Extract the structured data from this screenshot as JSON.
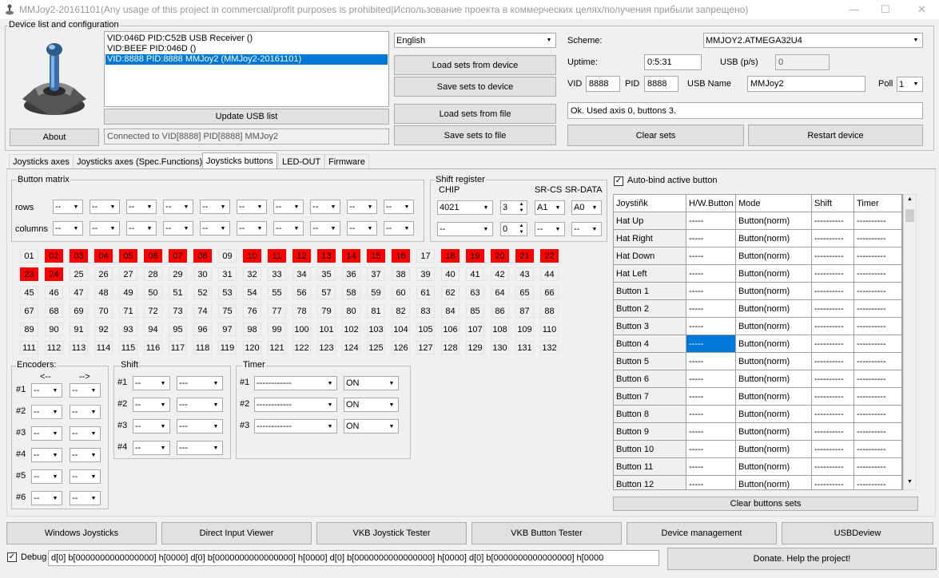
{
  "window": {
    "title": "MMJoy2-20161101(Any usage of this project in commercial/profit purposes is prohibited|Использование проекта в коммерческих целях/получения прибыли запрещено)",
    "min": "—",
    "max": "☐",
    "close": "✕"
  },
  "device": {
    "group_label": "Device list and configuration",
    "list": [
      "VID:046D PID:C52B USB Receiver ()",
      "VID:BEEF PID:046D  ()",
      "VID:8888 PID:8888 MMJoy2 (MMJoy2-20161101)"
    ],
    "selected_index": 2,
    "update_usb_label": "Update USB list",
    "about_label": "About",
    "status": "Connected to VID[8888] PID[8888] MMJoy2",
    "language": "English",
    "load_device_label": "Load sets from device",
    "save_device_label": "Save sets to device",
    "load_file_label": "Load sets from file",
    "save_file_label": "Save sets to file",
    "scheme_label": "Scheme:",
    "scheme": "MMJOY2.ATMEGA32U4",
    "uptime_label": "Uptime:",
    "uptime": "0:5:31",
    "usbps_label": "USB (p/s)",
    "usbps": "0",
    "vid_label": "VID",
    "vid": "8888",
    "pid_label": "PID",
    "pid": "8888",
    "usbname_label": "USB Name",
    "usbname": "MMJoy2",
    "poll_label": "Poll",
    "poll": "1",
    "info": "Ok. Used axis  0, buttons 3.",
    "clear_sets_label": "Clear sets",
    "restart_label": "Restart device"
  },
  "tabs": [
    "Joysticks axes",
    "Joysticks axes (Spec.Functions)",
    "Joysticks buttons",
    "LED-OUT",
    "Firmware"
  ],
  "active_tab": 2,
  "matrix": {
    "group_label": "Button matrix",
    "rows_label": "rows",
    "columns_label": "columns",
    "value": "--"
  },
  "shiftreg": {
    "group_label": "Shift register",
    "chip_label": "CHIP",
    "srcs_label": "SR-CS",
    "srdata_label": "SR-DATA",
    "chip1": "4021",
    "count1": "3",
    "cs1": "A1",
    "data1": "A0",
    "chip2": "--",
    "count2": "0",
    "cs2": "--",
    "data2": "--"
  },
  "buttons": {
    "labels": [
      "01",
      "02",
      "03",
      "04",
      "05",
      "06",
      "07",
      "08",
      "09",
      "10",
      "11",
      "12",
      "13",
      "14",
      "15",
      "16",
      "17",
      "18",
      "19",
      "20",
      "21",
      "22",
      "23",
      "24",
      "25",
      "26",
      "27",
      "28",
      "29",
      "30",
      "31",
      "32",
      "33",
      "34",
      "35",
      "36",
      "37",
      "38",
      "39",
      "40",
      "41",
      "42",
      "43",
      "44",
      "45",
      "46",
      "47",
      "48",
      "49",
      "50",
      "51",
      "52",
      "53",
      "54",
      "55",
      "56",
      "57",
      "58",
      "59",
      "60",
      "61",
      "62",
      "63",
      "64",
      "65",
      "66",
      "67",
      "68",
      "69",
      "70",
      "71",
      "72",
      "73",
      "74",
      "75",
      "76",
      "77",
      "78",
      "79",
      "80",
      "81",
      "82",
      "83",
      "84",
      "85",
      "86",
      "87",
      "88",
      "89",
      "90",
      "91",
      "92",
      "93",
      "94",
      "95",
      "96",
      "97",
      "98",
      "99",
      "100",
      "101",
      "102",
      "103",
      "104",
      "105",
      "106",
      "107",
      "108",
      "109",
      "110",
      "111",
      "112",
      "113",
      "114",
      "115",
      "116",
      "117",
      "118",
      "119",
      "120",
      "121",
      "122",
      "123",
      "124",
      "125",
      "126",
      "127",
      "128",
      "129",
      "130",
      "131",
      "132"
    ],
    "active": [
      "02",
      "03",
      "04",
      "05",
      "06",
      "07",
      "08",
      "10",
      "11",
      "12",
      "13",
      "14",
      "15",
      "16",
      "18",
      "19",
      "20",
      "21",
      "22",
      "23",
      "24"
    ],
    "active_color": "#ff0000"
  },
  "encoders": {
    "group_label": "Encoders:",
    "left_label": "<--",
    "right_label": "-->",
    "rows": [
      "#1",
      "#2",
      "#3",
      "#4",
      "#5",
      "#6"
    ],
    "value": "--"
  },
  "shift": {
    "group_label": "Shift",
    "rows": [
      "#1",
      "#2",
      "#3",
      "#4"
    ],
    "value1": "--",
    "value2": "---"
  },
  "timer": {
    "group_label": "Timer",
    "rows": [
      "#1",
      "#2",
      "#3"
    ],
    "value": "------------",
    "state": "ON"
  },
  "grid": {
    "autobind_label": "Auto-bind active button",
    "autobind_checked": "✓",
    "headers": [
      "Joystiñk",
      "H/W.Button",
      "Mode",
      "Shift",
      "Timer"
    ],
    "rows": [
      {
        "name": "Hat Up",
        "hw": "-----",
        "mode": "Button(norm)",
        "shift": "----------",
        "timer": "----------"
      },
      {
        "name": "Hat Right",
        "hw": "-----",
        "mode": "Button(norm)",
        "shift": "----------",
        "timer": "----------"
      },
      {
        "name": "Hat Down",
        "hw": "-----",
        "mode": "Button(norm)",
        "shift": "----------",
        "timer": "----------"
      },
      {
        "name": "Hat Left",
        "hw": "-----",
        "mode": "Button(norm)",
        "shift": "----------",
        "timer": "----------"
      },
      {
        "name": "Button 1",
        "hw": "-----",
        "mode": "Button(norm)",
        "shift": "----------",
        "timer": "----------"
      },
      {
        "name": "Button 2",
        "hw": "-----",
        "mode": "Button(norm)",
        "shift": "----------",
        "timer": "----------"
      },
      {
        "name": "Button 3",
        "hw": "-----",
        "mode": "Button(norm)",
        "shift": "----------",
        "timer": "----------"
      },
      {
        "name": "Button 4",
        "hw": "-----",
        "mode": "Button(norm)",
        "shift": "----------",
        "timer": "----------"
      },
      {
        "name": "Button 5",
        "hw": "-----",
        "mode": "Button(norm)",
        "shift": "----------",
        "timer": "----------"
      },
      {
        "name": "Button 6",
        "hw": "-----",
        "mode": "Button(norm)",
        "shift": "----------",
        "timer": "----------"
      },
      {
        "name": "Button 7",
        "hw": "-----",
        "mode": "Button(norm)",
        "shift": "----------",
        "timer": "----------"
      },
      {
        "name": "Button 8",
        "hw": "-----",
        "mode": "Button(norm)",
        "shift": "----------",
        "timer": "----------"
      },
      {
        "name": "Button 9",
        "hw": "-----",
        "mode": "Button(norm)",
        "shift": "----------",
        "timer": "----------"
      },
      {
        "name": "Button 10",
        "hw": "-----",
        "mode": "Button(norm)",
        "shift": "----------",
        "timer": "----------"
      },
      {
        "name": "Button 11",
        "hw": "-----",
        "mode": "Button(norm)",
        "shift": "----------",
        "timer": "----------"
      },
      {
        "name": "Button 12",
        "hw": "-----",
        "mode": "Button(norm)",
        "shift": "----------",
        "timer": "----------"
      }
    ],
    "selected_row": 7,
    "clear_buttons_label": "Clear buttons sets"
  },
  "bottom": {
    "windows_joysticks": "Windows Joysticks",
    "direct_input": "Direct Input Viewer",
    "vkb_joystick": "VKB Joystick Tester",
    "vkb_button": "VKB Button Tester",
    "device_mgmt": "Device management",
    "usbdeview": "USBDeview",
    "debug_label": "Debug",
    "debug_checked": "✓",
    "debug_text": "d[0] b[0000000000000000] h[0000]   d[0] b[0000000000000000] h[0000]   d[0] b[0000000000000000] h[0000]   d[0] b[0000000000000000] h[0000",
    "donate": "Donate. Help the project!"
  },
  "icons": {
    "arrow_down": "▼",
    "arrow_up": "▲",
    "app": "joystick-logo"
  }
}
